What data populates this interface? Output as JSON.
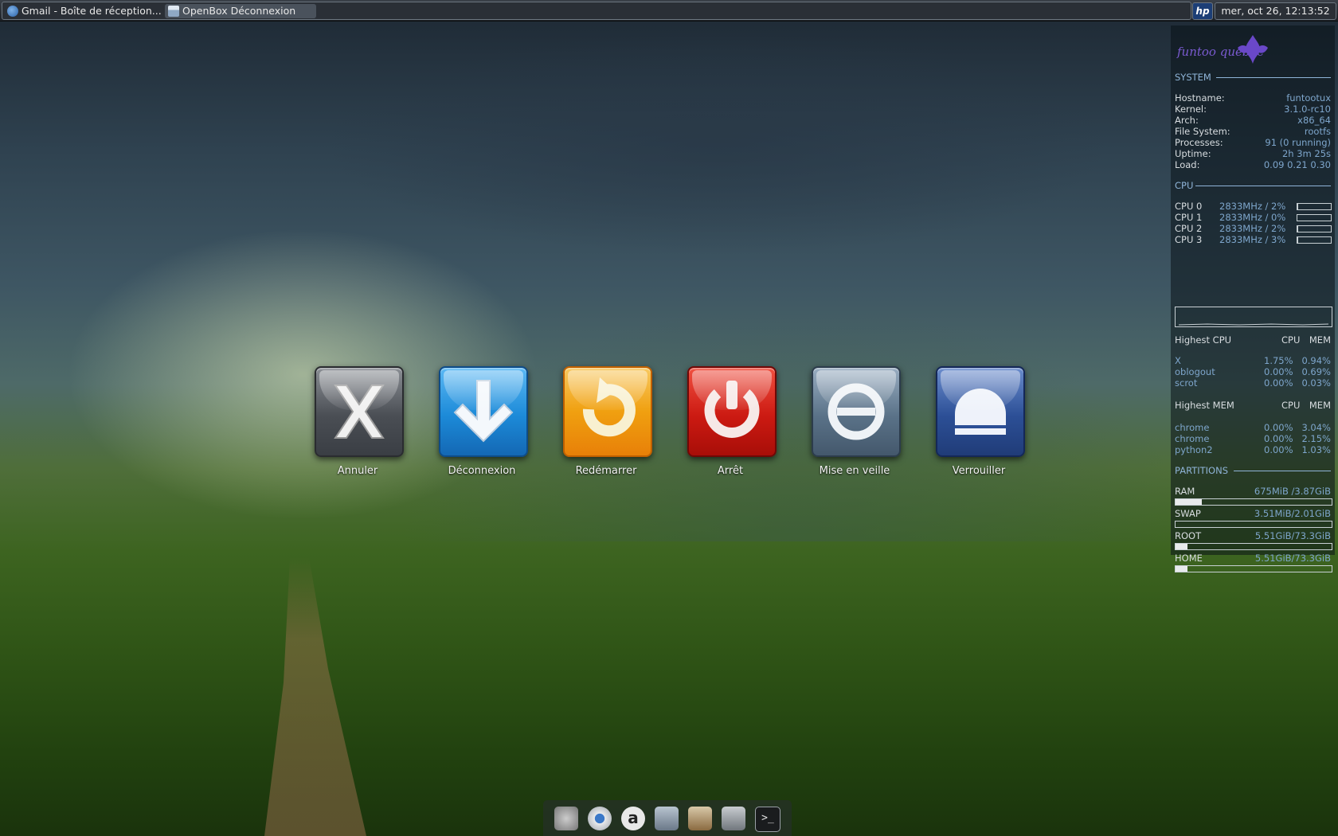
{
  "taskbar": {
    "tasks": [
      {
        "label": "Gmail - Boîte de réception..."
      },
      {
        "label": "OpenBox Déconnexion"
      }
    ],
    "hp_label": "hp",
    "clock": "mer, oct 26, 12:13:52"
  },
  "conky": {
    "logo_text": "funtoo quebec",
    "system": {
      "title": "SYSTEM",
      "rows": [
        {
          "label": "Hostname:",
          "value": "funtootux"
        },
        {
          "label": "Kernel:",
          "value": "3.1.0-rc10"
        },
        {
          "label": "Arch:",
          "value": "x86_64"
        },
        {
          "label": "File System:",
          "value": "rootfs"
        },
        {
          "label": "Processes:",
          "value": "91  (0  running)"
        },
        {
          "label": "Uptime:",
          "value": "2h 3m 25s"
        },
        {
          "label": "Load:",
          "value": "0.09 0.21 0.30"
        }
      ]
    },
    "cpu": {
      "title": "CPU",
      "cores": [
        {
          "label": "CPU 0",
          "value": "2833MHz / 2%",
          "pct": 2
        },
        {
          "label": "CPU 1",
          "value": "2833MHz / 0%",
          "pct": 0
        },
        {
          "label": "CPU 2",
          "value": "2833MHz / 2%",
          "pct": 2
        },
        {
          "label": "CPU 3",
          "value": "2833MHz / 3%",
          "pct": 3
        }
      ]
    },
    "highest_cpu": {
      "title": "Highest CPU",
      "col_cpu": "CPU",
      "col_mem": "MEM",
      "rows": [
        {
          "name": "X",
          "cpu": "1.75%",
          "mem": "0.94%"
        },
        {
          "name": "oblogout",
          "cpu": "0.00%",
          "mem": "0.69%"
        },
        {
          "name": "scrot",
          "cpu": "0.00%",
          "mem": "0.03%"
        }
      ]
    },
    "highest_mem": {
      "title": "Highest MEM",
      "col_cpu": "CPU",
      "col_mem": "MEM",
      "rows": [
        {
          "name": "chrome",
          "cpu": "0.00%",
          "mem": "3.04%"
        },
        {
          "name": "chrome",
          "cpu": "0.00%",
          "mem": "2.15%"
        },
        {
          "name": "python2",
          "cpu": "0.00%",
          "mem": "1.03%"
        }
      ]
    },
    "partitions": {
      "title": "PARTITIONS",
      "rows": [
        {
          "label": "RAM",
          "value": "675MiB /3.87GiB",
          "pct": 17
        },
        {
          "label": "SWAP",
          "value": "3.51MiB/2.01GiB",
          "pct": 0
        },
        {
          "label": "ROOT",
          "value": "5.51GiB/73.3GiB",
          "pct": 7.5
        },
        {
          "label": "HOME",
          "value": "5.51GiB/73.3GiB",
          "pct": 7.5
        }
      ]
    }
  },
  "logout": {
    "buttons": [
      {
        "label": "Annuler",
        "icon": "cancel-icon",
        "color": "#555a60"
      },
      {
        "label": "Déconnexion",
        "icon": "logout-arrow-icon",
        "color": "#1c8ad8"
      },
      {
        "label": "Redémarrer",
        "icon": "restart-icon",
        "color": "#f0a010"
      },
      {
        "label": "Arrêt",
        "icon": "power-icon",
        "color": "#cc1a12"
      },
      {
        "label": "Mise en veille",
        "icon": "suspend-icon",
        "color": "#5a7288"
      },
      {
        "label": "Verrouiller",
        "icon": "lock-icon",
        "color": "#2c4f96"
      }
    ]
  },
  "dock": {
    "items": [
      "funtoo-icon",
      "chrome-icon",
      "app-a-icon",
      "users-icon",
      "archive-icon",
      "camera-icon",
      "terminal-icon"
    ]
  }
}
